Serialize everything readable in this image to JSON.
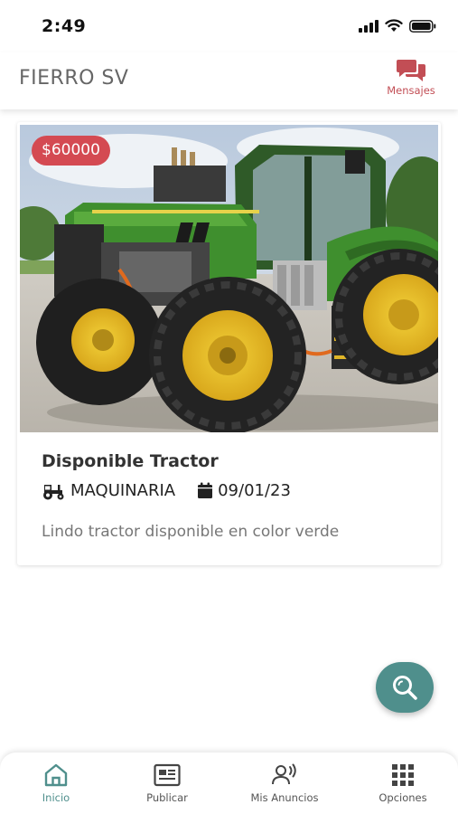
{
  "status": {
    "time": "2:49"
  },
  "header": {
    "title": "FIERRO SV",
    "messages_label": "Mensajes"
  },
  "listing": {
    "price": "$60000",
    "title": "Disponible Tractor",
    "category": "MAQUINARIA",
    "date": "09/01/23",
    "description": "Lindo tractor disponible en color verde"
  },
  "nav": {
    "items": [
      {
        "label": "Inicio",
        "icon": "home-icon",
        "active": true
      },
      {
        "label": "Publicar",
        "icon": "newspaper-icon"
      },
      {
        "label": "Mis Anuncios",
        "icon": "announcement-icon"
      },
      {
        "label": "Opciones",
        "icon": "grid-icon"
      }
    ]
  },
  "colors": {
    "accent": "#4f8f8c",
    "price_badge": "#d44a52",
    "messages": "#c24e55"
  }
}
